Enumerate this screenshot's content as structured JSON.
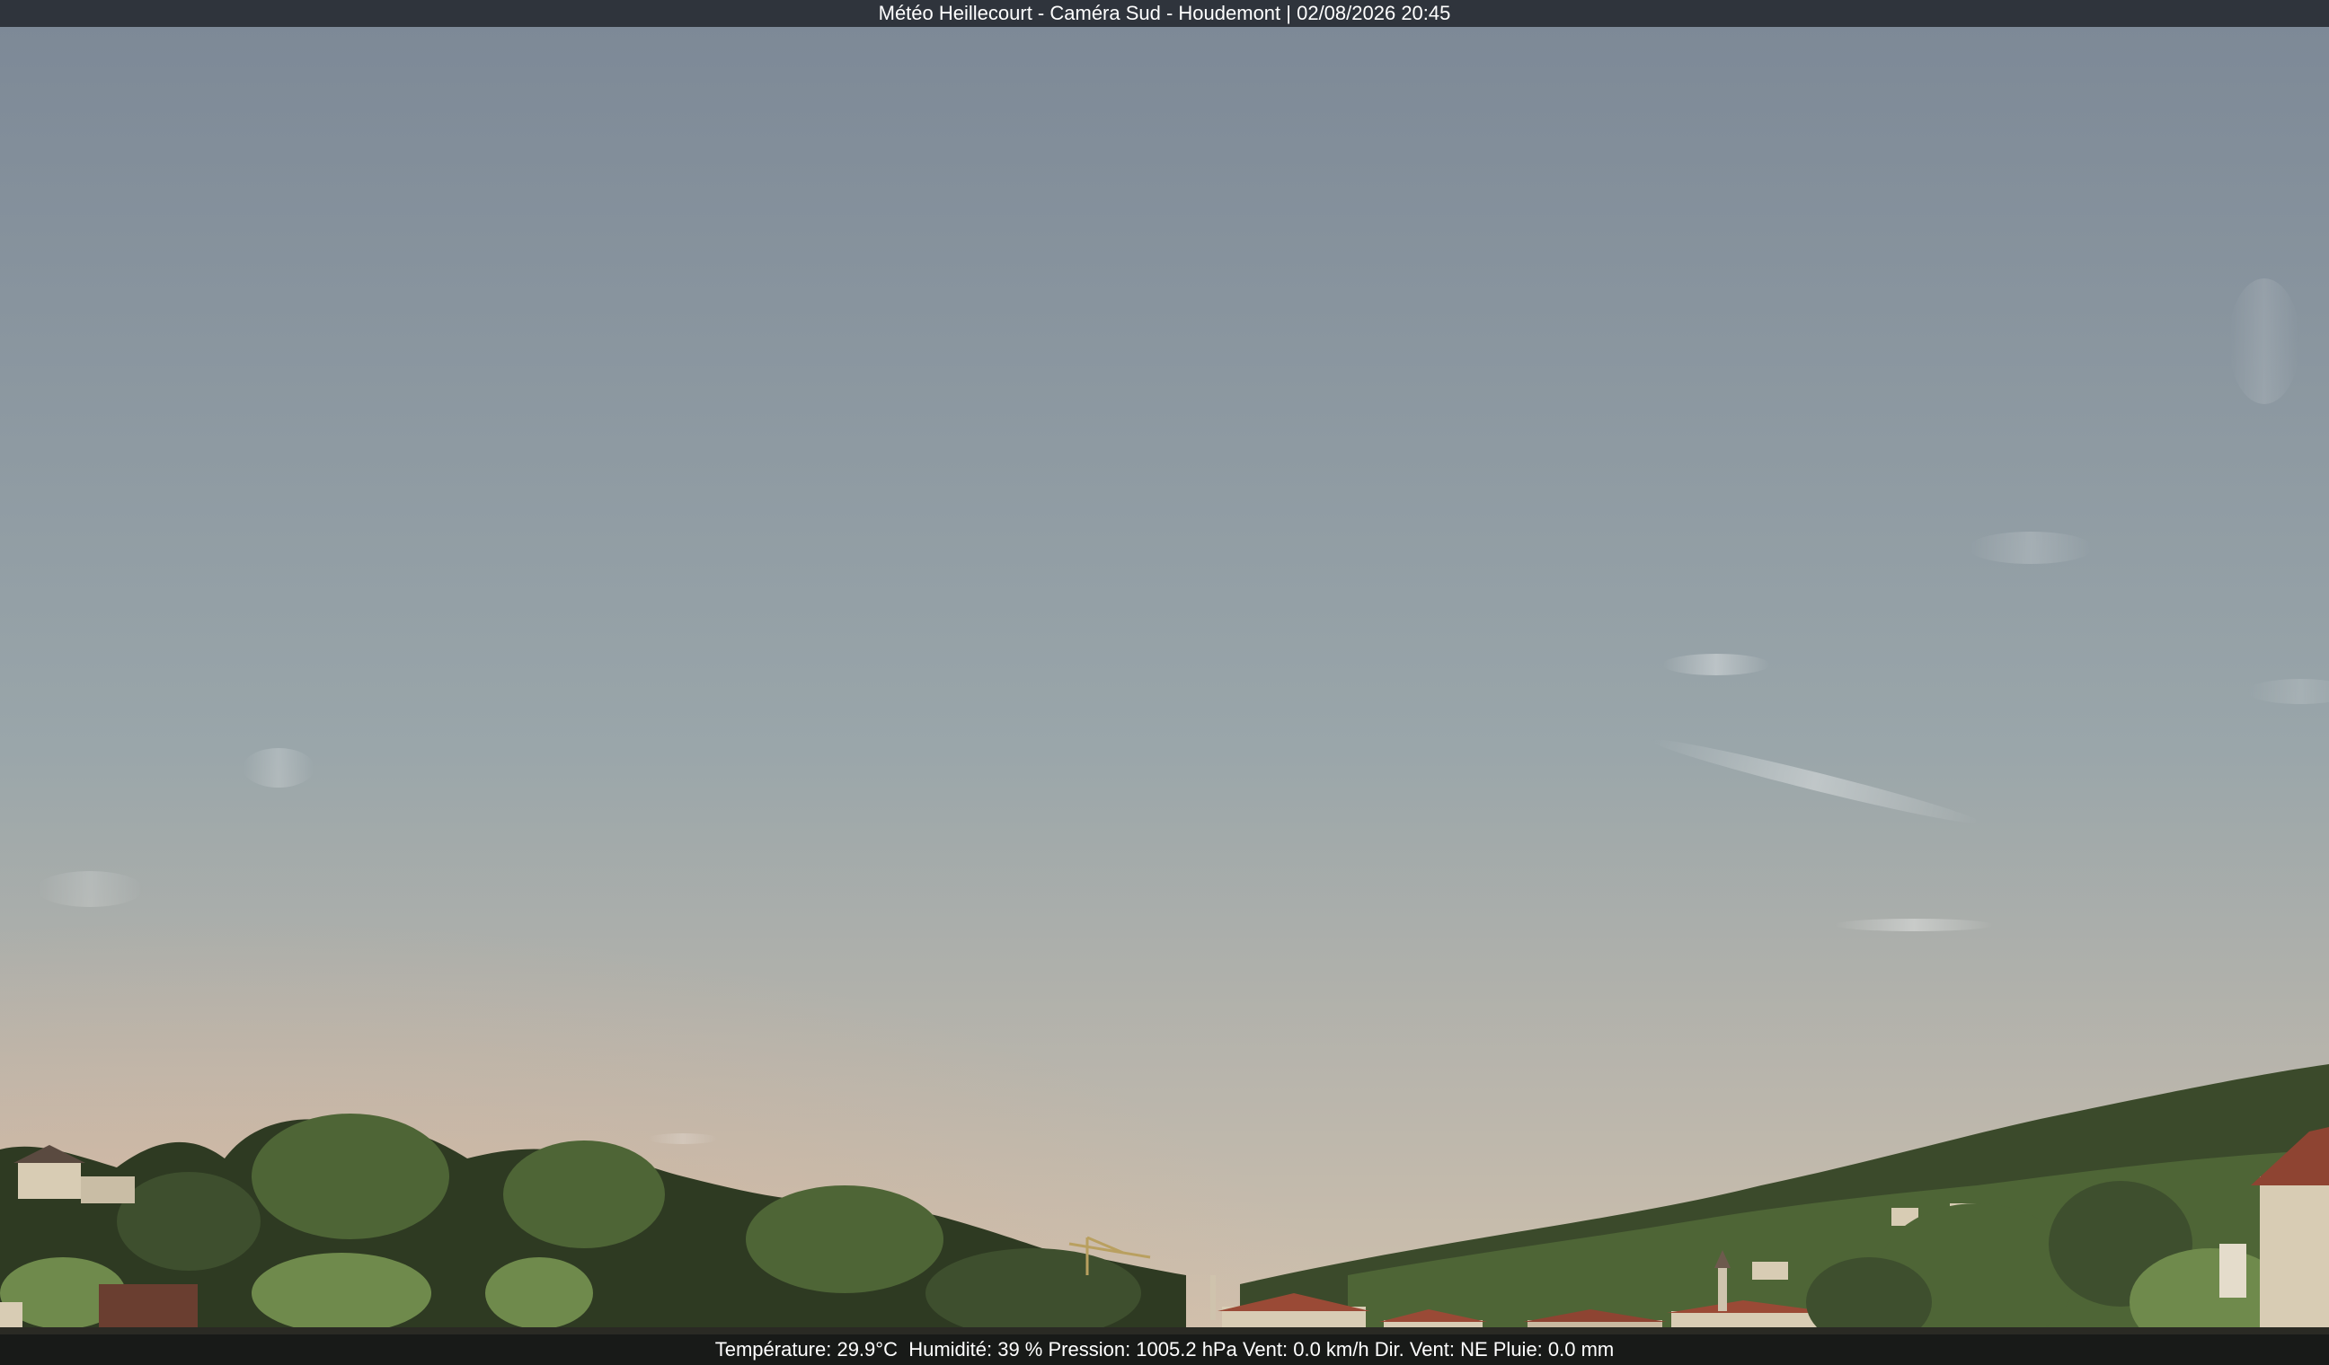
{
  "title_bar": {
    "text": "Météo Heillecourt - Caméra Sud - Houdemont | 02/08/2026 20:45"
  },
  "info_bar": {
    "text": "Température: 29.9°C  Humidité: 39 % Pression: 1005.2 hPa Vent: 0.0 km/h Dir. Vent: NE Pluie: 0.0 mm"
  },
  "colors": {
    "sky_top": "#7c8896",
    "sky_middle": "#9aa6aa",
    "sky_horizon": "#d3c2ad",
    "horizon_glow": "#e0b89c",
    "trees_dark": "#2e3a22",
    "trees_mid": "#4e6536",
    "trees_light": "#6f8a4c",
    "roof": "#9a4a36",
    "wall": "#d8ccb4",
    "title_bar_bg": "#282c34"
  }
}
